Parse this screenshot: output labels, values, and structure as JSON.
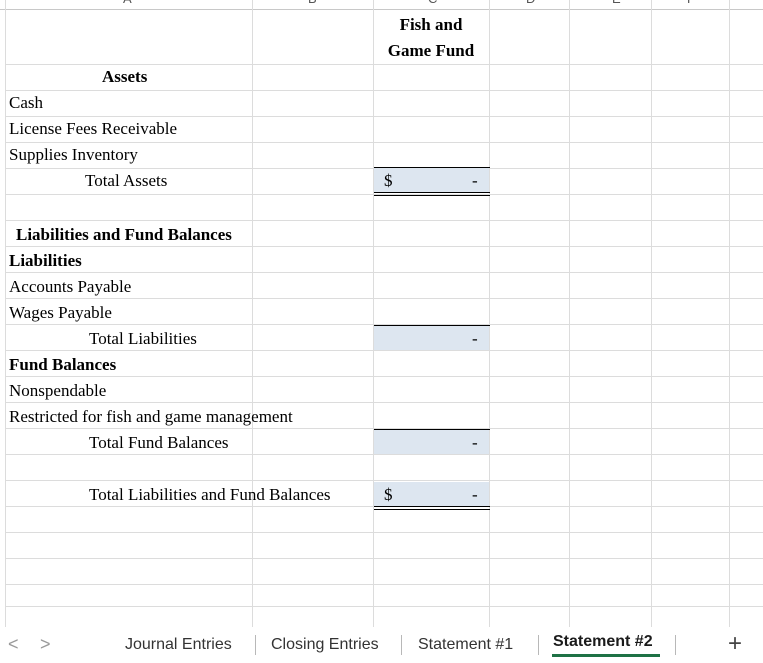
{
  "columns": [
    "A",
    "B",
    "C",
    "D",
    "E",
    "F"
  ],
  "header": {
    "line1": "Fish and",
    "line2": "Game Fund"
  },
  "rows": {
    "assets_heading": "Assets",
    "cash": "Cash",
    "license_fees": "License Fees Receivable",
    "supplies": "Supplies Inventory",
    "total_assets": "Total Assets",
    "liab_fb_heading": "Liabilities and Fund Balances",
    "liabilities_heading": "Liabilities",
    "accounts_payable": "Accounts Payable",
    "wages_payable": "Wages Payable",
    "total_liabilities": "Total Liabilities",
    "fund_balances_heading": "Fund Balances",
    "nonspendable": "Nonspendable",
    "restricted": "Restricted for fish and game management",
    "total_fund_balances": "Total Fund Balances",
    "total_liab_fb": "Total Liabilities and Fund Balances"
  },
  "values": {
    "total_assets_symbol": "$",
    "total_assets_value": "-",
    "total_liabilities_value": "-",
    "total_fund_balances_value": "-",
    "total_liab_fb_symbol": "$",
    "total_liab_fb_value": "-"
  },
  "tabs": {
    "prev": "<",
    "next": ">",
    "items": [
      "Journal Entries",
      "Closing Entries",
      "Statement #1",
      "Statement #2"
    ],
    "active": "Statement #2",
    "add": "+"
  },
  "colors": {
    "fill": "#dde6f0",
    "active_tab_underline": "#1e7145"
  }
}
